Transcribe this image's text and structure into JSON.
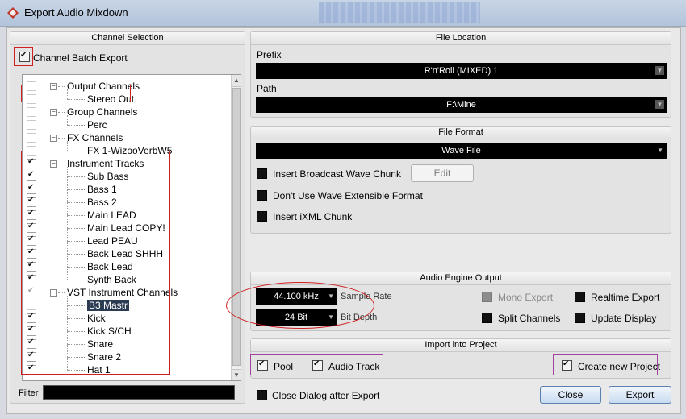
{
  "window": {
    "title": "Export Audio Mixdown"
  },
  "channel_selection": {
    "header": "Channel Selection",
    "batch_export_label": "Channel Batch Export",
    "batch_export_checked": true,
    "tree": [
      {
        "label": "Output Channels",
        "level": 0,
        "checked": false,
        "group": true
      },
      {
        "label": "Stereo Out",
        "level": 1,
        "checked": false
      },
      {
        "label": "Group Channels",
        "level": 0,
        "checked": false,
        "group": true
      },
      {
        "label": "Perc",
        "level": 1,
        "checked": false
      },
      {
        "label": "FX Channels",
        "level": 0,
        "checked": false,
        "group": true
      },
      {
        "label": "FX 1-WizooVerbW5",
        "level": 1,
        "checked": false
      },
      {
        "label": "Instrument Tracks",
        "level": 0,
        "checked": true,
        "group": true
      },
      {
        "label": "Sub Bass",
        "level": 1,
        "checked": true
      },
      {
        "label": "Bass 1",
        "level": 1,
        "checked": true
      },
      {
        "label": "Bass 2",
        "level": 1,
        "checked": true
      },
      {
        "label": "Main LEAD",
        "level": 1,
        "checked": true
      },
      {
        "label": "Main Lead COPY!",
        "level": 1,
        "checked": true
      },
      {
        "label": "Lead PEAU",
        "level": 1,
        "checked": true
      },
      {
        "label": "Back Lead SHHH",
        "level": 1,
        "checked": true
      },
      {
        "label": "Back Lead",
        "level": 1,
        "checked": true
      },
      {
        "label": "Synth Back",
        "level": 1,
        "checked": true
      },
      {
        "label": "VST Instrument Channels",
        "level": 0,
        "checked": true,
        "partial": true,
        "group": true
      },
      {
        "label": "B3 Mastr",
        "level": 1,
        "checked": false,
        "selected": true
      },
      {
        "label": "Kick",
        "level": 1,
        "checked": true
      },
      {
        "label": "Kick S/CH",
        "level": 1,
        "checked": true
      },
      {
        "label": "Snare",
        "level": 1,
        "checked": true
      },
      {
        "label": "Snare 2",
        "level": 1,
        "checked": true
      },
      {
        "label": "Hat 1",
        "level": 1,
        "checked": true
      }
    ],
    "filter_label": "Filter",
    "filter_value": ""
  },
  "file_location": {
    "header": "File Location",
    "prefix_label": "Prefix",
    "prefix_value": "R'n'Roll (MIXED) 1",
    "path_label": "Path",
    "path_value": "F:\\Mine"
  },
  "file_format": {
    "header": "File Format",
    "format_value": "Wave File",
    "broadcast_label": "Insert Broadcast Wave Chunk",
    "edit_label": "Edit",
    "extensible_label": "Don't Use Wave Extensible Format",
    "ixml_label": "Insert iXML Chunk"
  },
  "audio_engine": {
    "header": "Audio Engine Output",
    "sample_rate_value": "44.100 kHz",
    "sample_rate_label": "Sample Rate",
    "bit_depth_value": "24 Bit",
    "bit_depth_label": "Bit Depth",
    "mono_export_label": "Mono Export",
    "split_channels_label": "Split Channels",
    "realtime_export_label": "Realtime Export",
    "update_display_label": "Update Display"
  },
  "import_project": {
    "header": "Import into Project",
    "pool_label": "Pool",
    "audio_track_label": "Audio Track",
    "create_project_label": "Create new Project"
  },
  "footer": {
    "close_dialog_label": "Close Dialog after Export",
    "close_button": "Close",
    "export_button": "Export"
  },
  "colors": {
    "annotation_red": "#d01f1f",
    "annotation_purple": "#a142a1",
    "combo_bg": "#000000"
  }
}
